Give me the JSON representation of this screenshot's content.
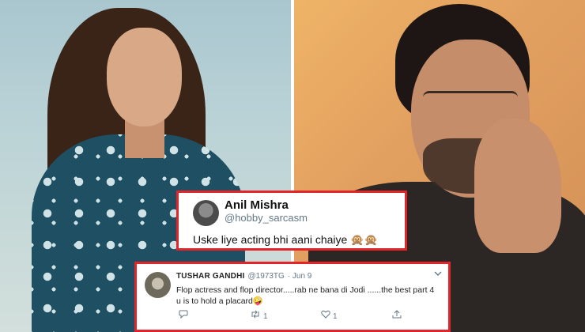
{
  "tweet1": {
    "name": "Anil Mishra",
    "handle": "@hobby_sarcasm",
    "text": "Uske liye acting bhi aani chaiye 🙊🙊"
  },
  "tweet2": {
    "name": "TUSHAR GANDHI",
    "handle": "@1973TG",
    "date": "· Jun 9",
    "text": "Flop actress and flop director.....rab ne bana di Jodi ......the best part 4 u is to hold a placard🤪",
    "retweets": "1",
    "likes": "1",
    "icons": [
      "reply-icon",
      "retweet-icon",
      "like-icon",
      "share-icon",
      "chevron-down-icon"
    ]
  },
  "colors": {
    "highlight_border": "#e0262b",
    "handle_gray": "#657786"
  }
}
